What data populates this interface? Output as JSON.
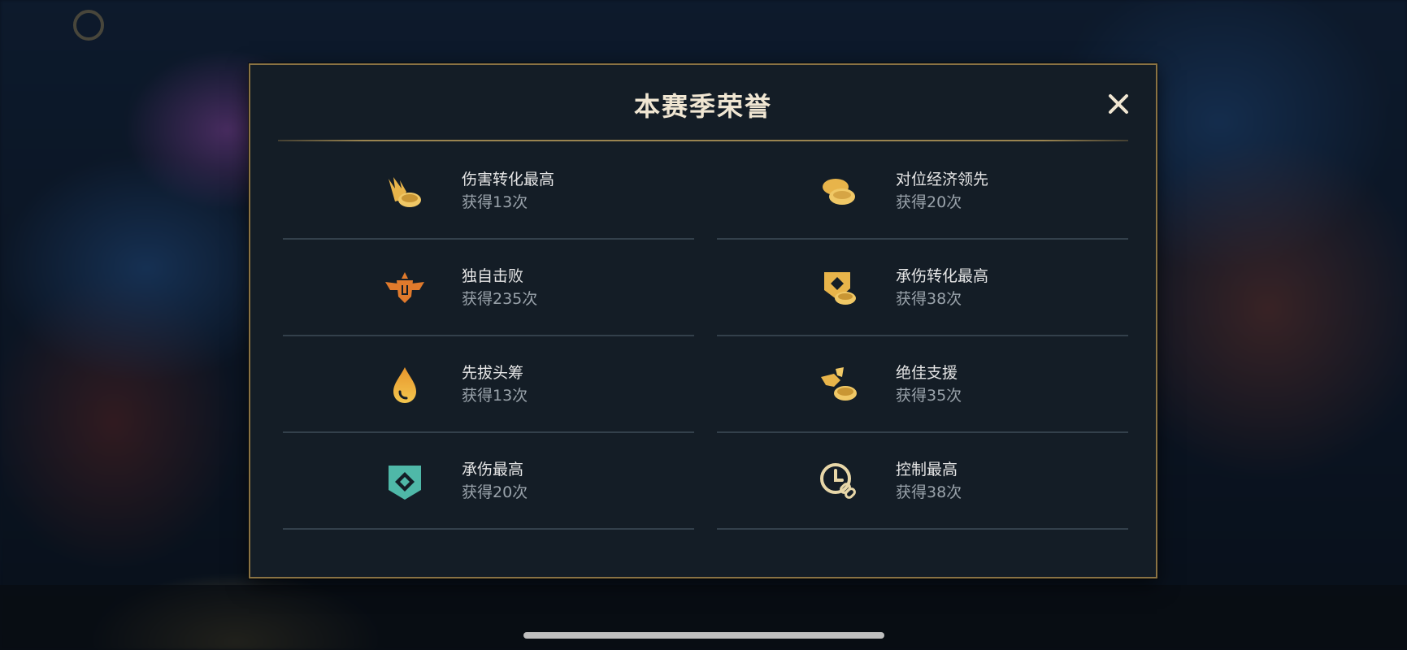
{
  "modal": {
    "title": "本赛季荣誉",
    "close_label": "×",
    "honors": [
      {
        "name": "伤害转化最高",
        "count": "获得13次",
        "icon": "flame-coin-icon"
      },
      {
        "name": "对位经济领先",
        "count": "获得20次",
        "icon": "coins-icon"
      },
      {
        "name": "独自击败",
        "count": "获得235次",
        "icon": "winged-emblem-icon"
      },
      {
        "name": "承伤转化最高",
        "count": "获得38次",
        "icon": "shield-coin-icon"
      },
      {
        "name": "先拔头筹",
        "count": "获得13次",
        "icon": "blood-drop-icon"
      },
      {
        "name": "绝佳支援",
        "count": "获得35次",
        "icon": "wing-coin-icon"
      },
      {
        "name": "承伤最高",
        "count": "获得20次",
        "icon": "diamond-shield-icon"
      },
      {
        "name": "控制最高",
        "count": "获得38次",
        "icon": "clock-chain-icon"
      }
    ]
  },
  "colors": {
    "gold": "#e8b44a",
    "orange": "#e07a2c",
    "teal": "#4fb8a8",
    "light_gold": "#e8d7a8",
    "panel_bg": "#141d26",
    "border": "#8a7344"
  }
}
